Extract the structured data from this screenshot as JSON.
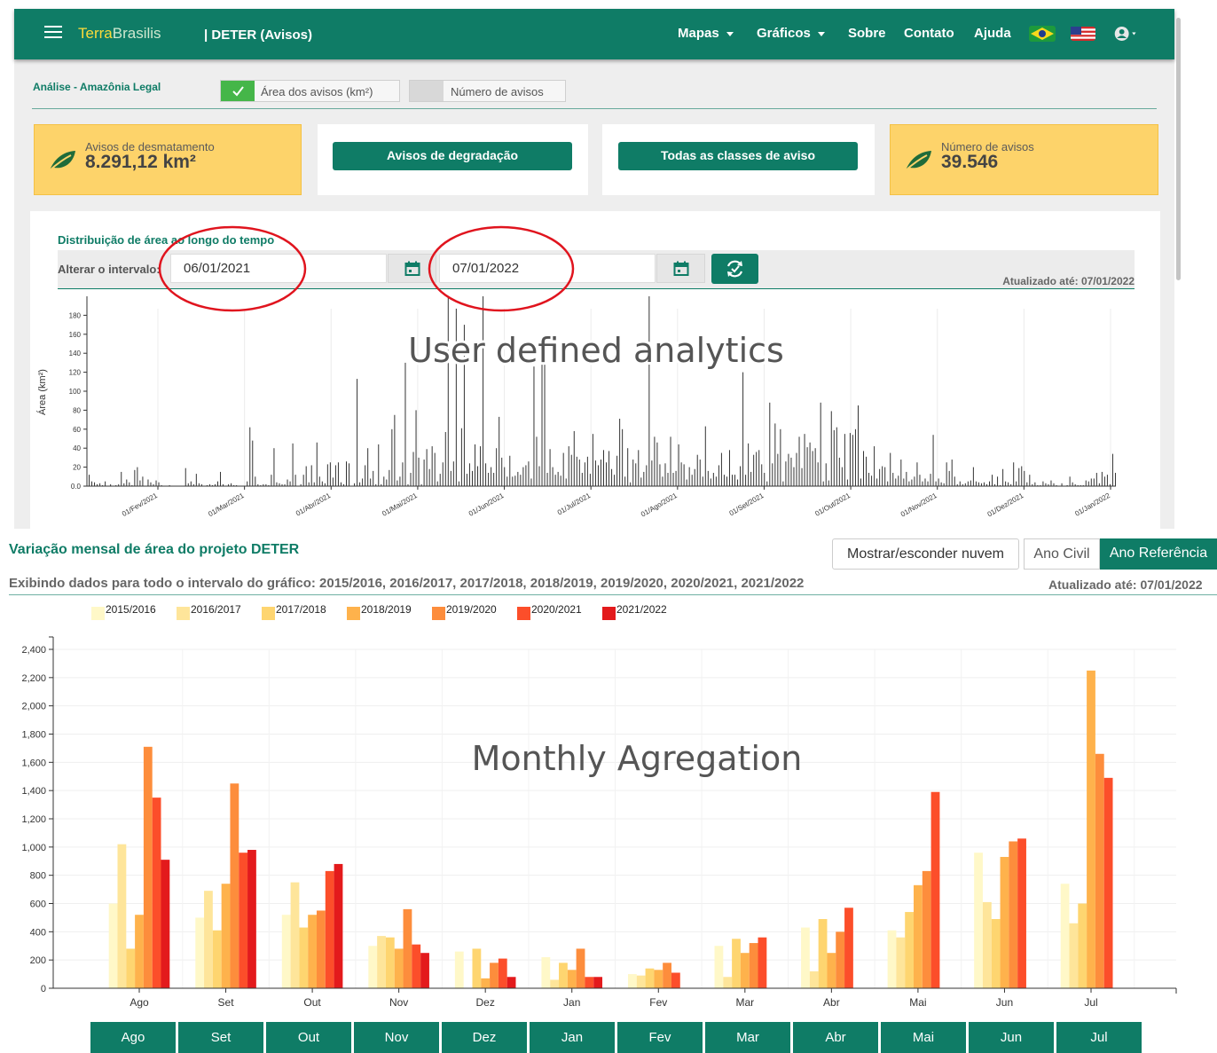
{
  "navbar": {
    "brand_part1": "Terra",
    "brand_part2": "Brasilis",
    "title": "| DETER (Avisos)",
    "items": [
      "Mapas",
      "Gráficos",
      "Sobre",
      "Contato",
      "Ajuda"
    ]
  },
  "analysis": {
    "title": "Análise - Amazônia Legal",
    "toggle_area_label": "Área dos avisos (km²)",
    "toggle_count_label": "Número de avisos",
    "toggle_area_on": true,
    "toggle_count_on": false
  },
  "cards": {
    "deforestation_label": "Avisos de desmatamento",
    "deforestation_value": "8.291,12 km²",
    "degradation_button": "Avisos de degradação",
    "all_classes_button": "Todas as classes de aviso",
    "count_label": "Número de avisos",
    "count_value": "39.546"
  },
  "chart1": {
    "title": "Distribuição de área ao longo do tempo",
    "range_label": "Alterar o intervalo:",
    "start_date": "06/01/2021",
    "end_date": "07/01/2022",
    "updated": "Atualizado até: 07/01/2022",
    "annotation": "User defined analytics"
  },
  "chart2": {
    "title": "Variação mensal de área do projeto DETER",
    "btn_cloud": "Mostrar/esconder nuvem",
    "btn_civil": "Ano Civil",
    "btn_ref": "Ano Referência",
    "subtitle": "Exibindo dados para todo o intervalo do gráfico: 2015/2016, 2016/2017, 2017/2018, 2018/2019, 2019/2020, 2020/2021, 2021/2022",
    "updated": "Atualizado até: 07/01/2022",
    "annotation": "Monthly Agregation"
  },
  "month_tabs": [
    "Ago",
    "Set",
    "Out",
    "Nov",
    "Dez",
    "Jan",
    "Fev",
    "Mar",
    "Abr",
    "Mai",
    "Jun",
    "Jul"
  ],
  "colors": {
    "primary": "#0f7c66",
    "card_yellow": "#fdd36a",
    "annotation_red": "#e0141e"
  },
  "chart_data": [
    {
      "type": "bar",
      "ylabel": "Área (km²)",
      "xlabel": "",
      "ylim": [
        0,
        190
      ],
      "yticks": [
        0,
        20,
        40,
        60,
        80,
        100,
        120,
        140,
        160,
        180
      ],
      "ytick_labels": [
        "0.0",
        "20",
        "40",
        "60",
        "80",
        "100",
        "120",
        "140",
        "160",
        "180"
      ],
      "x_start": "06/01/2021",
      "x_end": "07/01/2022",
      "x_tick_labels": [
        "01/Fev/2021",
        "01/Mar/2021",
        "01/Abr/2021",
        "01/Mai/2021",
        "01/Jun/2021",
        "01/Jul/2021",
        "01/Ago/2021",
        "01/Set/2021",
        "01/Out/2021",
        "01/Nov/2021",
        "01/Dez/2021",
        "01/Jan/2022"
      ],
      "values": [
        12,
        5,
        4,
        2,
        3,
        1,
        5,
        0,
        2,
        0,
        1,
        2,
        15,
        3,
        7,
        4,
        1,
        17,
        20,
        6,
        10,
        0,
        7,
        4,
        2,
        6,
        4,
        1,
        0,
        0,
        1,
        0,
        0,
        0,
        0,
        0,
        19,
        3,
        5,
        2,
        13,
        3,
        2,
        0,
        1,
        2,
        1,
        2,
        5,
        15,
        2,
        0,
        2,
        3,
        1,
        1,
        0,
        0,
        0,
        5,
        62,
        48,
        10,
        2,
        1,
        2,
        2,
        1,
        12,
        40,
        4,
        3,
        2,
        2,
        7,
        5,
        45,
        12,
        0,
        2,
        12,
        21,
        4,
        22,
        4,
        46,
        10,
        5,
        3,
        23,
        25,
        9,
        22,
        25,
        4,
        2,
        26,
        24,
        0,
        3,
        113,
        4,
        8,
        22,
        40,
        8,
        16,
        2,
        44,
        2,
        10,
        7,
        17,
        60,
        75,
        6,
        10,
        25,
        130,
        2,
        14,
        36,
        80,
        30,
        2,
        28,
        39,
        18,
        42,
        35,
        5,
        13,
        25,
        57,
        200,
        16,
        26,
        187,
        5,
        61,
        170,
        13,
        24,
        16,
        44,
        21,
        42,
        200,
        24,
        14,
        20,
        14,
        40,
        73,
        30,
        20,
        10,
        32,
        10,
        11,
        15,
        12,
        20,
        22,
        26,
        8,
        126,
        52,
        21,
        130,
        134,
        14,
        39,
        20,
        12,
        15,
        11,
        35,
        8,
        42,
        33,
        58,
        31,
        28,
        14,
        25,
        31,
        13,
        55,
        27,
        22,
        28,
        38,
        25,
        37,
        18,
        12,
        32,
        71,
        60,
        10,
        40,
        4,
        28,
        24,
        38,
        9,
        15,
        22,
        200,
        27,
        52,
        46,
        23,
        10,
        24,
        14,
        52,
        14,
        16,
        44,
        25,
        23,
        7,
        20,
        12,
        18,
        33,
        28,
        10,
        63,
        16,
        8,
        14,
        10,
        22,
        35,
        12,
        10,
        38,
        12,
        12,
        7,
        21,
        120,
        12,
        45,
        15,
        33,
        36,
        38,
        23,
        14,
        5,
        88,
        24,
        66,
        34,
        60,
        5,
        26,
        34,
        30,
        20,
        35,
        52,
        19,
        55,
        41,
        46,
        37,
        40,
        25,
        88,
        5,
        24,
        6,
        79,
        59,
        62,
        30,
        20,
        55,
        7,
        56,
        54,
        60,
        85,
        8,
        37,
        31,
        14,
        11,
        42,
        8,
        18,
        21,
        20,
        5,
        35,
        14,
        8,
        11,
        28,
        8,
        15,
        5,
        7,
        10,
        25,
        12,
        5,
        8,
        5,
        13,
        54,
        5,
        8,
        4,
        3,
        25,
        16,
        28,
        10,
        2,
        5,
        2,
        3,
        5,
        6,
        20,
        5,
        4,
        3,
        4,
        2,
        5,
        12,
        2,
        10,
        1,
        18,
        5,
        4,
        2,
        25,
        5,
        19,
        21,
        16,
        4,
        12,
        2,
        4,
        1,
        1,
        5,
        3,
        2,
        6,
        3,
        1,
        0,
        3,
        0,
        1,
        10,
        4,
        2,
        1,
        1,
        1,
        6,
        5,
        8,
        8,
        14,
        3,
        15,
        10,
        12,
        2,
        34,
        14
      ]
    },
    {
      "type": "bar",
      "title": "Variação mensal de área do projeto DETER",
      "xlabel": "",
      "ylabel": "",
      "ylim": [
        0,
        2400
      ],
      "yticks": [
        0,
        200,
        400,
        600,
        800,
        1000,
        1200,
        1400,
        1600,
        1800,
        2000,
        2200,
        2400
      ],
      "ytick_labels": [
        "0",
        "200",
        "400",
        "600",
        "800",
        "1,000",
        "1,200",
        "1,400",
        "1,600",
        "1,800",
        "2,000",
        "2,200",
        "2,400"
      ],
      "legend_position": "top-left",
      "categories": [
        "Ago",
        "Set",
        "Out",
        "Nov",
        "Dez",
        "Jan",
        "Fev",
        "Mar",
        "Abr",
        "Mai",
        "Jun",
        "Jul"
      ],
      "series": [
        {
          "name": "2015/2016",
          "color": "#fff8c8",
          "values": [
            600,
            500,
            520,
            300,
            260,
            220,
            100,
            300,
            430,
            410,
            960,
            740
          ]
        },
        {
          "name": "2016/2017",
          "color": "#fee59a",
          "values": [
            1020,
            690,
            750,
            370,
            0,
            60,
            90,
            80,
            120,
            360,
            610,
            460
          ]
        },
        {
          "name": "2017/2018",
          "color": "#fed570",
          "values": [
            280,
            410,
            430,
            360,
            280,
            180,
            140,
            350,
            490,
            540,
            490,
            600
          ]
        },
        {
          "name": "2018/2019",
          "color": "#feb24c",
          "values": [
            520,
            740,
            520,
            280,
            70,
            130,
            130,
            250,
            250,
            730,
            930,
            2250
          ]
        },
        {
          "name": "2019/2020",
          "color": "#fd8d3c",
          "values": [
            1710,
            1450,
            550,
            560,
            180,
            280,
            180,
            320,
            400,
            830,
            1040,
            1660
          ]
        },
        {
          "name": "2020/2021",
          "color": "#fc4e2a",
          "values": [
            1350,
            960,
            830,
            310,
            210,
            80,
            110,
            360,
            570,
            1390,
            1060,
            1490
          ]
        },
        {
          "name": "2021/2022",
          "color": "#e31a1c",
          "values": [
            910,
            980,
            880,
            250,
            80,
            80,
            0,
            0,
            0,
            0,
            0,
            0
          ]
        }
      ]
    }
  ]
}
